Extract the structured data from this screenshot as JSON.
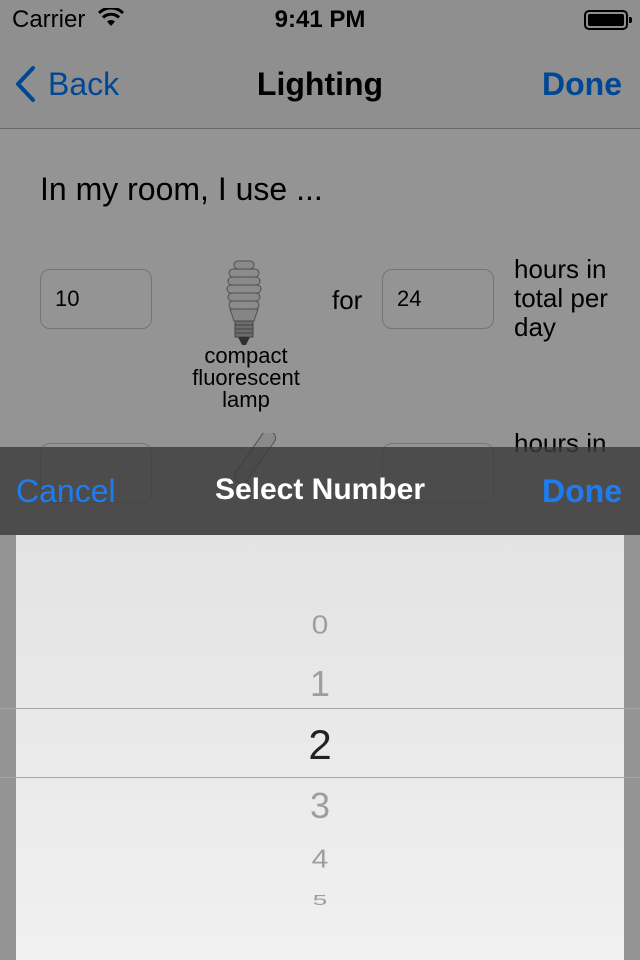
{
  "status_bar": {
    "carrier": "Carrier",
    "time": "9:41 PM"
  },
  "nav": {
    "back_label": "Back",
    "title": "Lighting",
    "done_label": "Done"
  },
  "content": {
    "intro": "In my room, I use ...",
    "rows": [
      {
        "count": "10",
        "lamp": "compact fluorescent lamp",
        "for": "for",
        "hours": "24",
        "hours_label": "hours in total per day"
      },
      {
        "hours_label": "hours in"
      }
    ]
  },
  "picker": {
    "cancel_label": "Cancel",
    "title": "Select Number",
    "done_label": "Done",
    "options": [
      "0",
      "1",
      "2",
      "3",
      "4",
      "5"
    ],
    "selected": "2"
  },
  "colors": {
    "accent": "#007aff",
    "toolbar_accent": "#1e7cf0"
  }
}
